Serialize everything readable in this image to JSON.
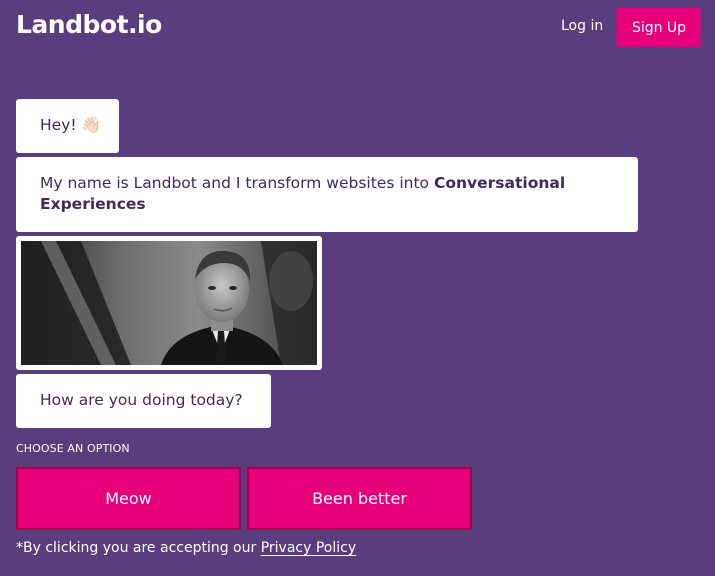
{
  "header": {
    "logo_text": "Landbot.io",
    "login_label": "Log in",
    "signup_label": "Sign Up"
  },
  "chat": {
    "greeting": "Hey! 👋🏻",
    "intro_text": "My name is Landbot and I transform websites into ",
    "intro_bold": "Conversational Experiences",
    "gif_alt": "animated gif of a man in a suit",
    "question": "How are you doing today?"
  },
  "options": {
    "label": "CHOOSE AN OPTION",
    "items": [
      {
        "label": "Meow"
      },
      {
        "label": "Been better"
      }
    ]
  },
  "footer": {
    "disclaimer_prefix": "*By clicking you are accepting our ",
    "privacy_label": "Privacy Policy"
  },
  "colors": {
    "background": "#5a3d7d",
    "accent": "#e8007a",
    "bubble": "#ffffff",
    "text": "#3f2a59"
  }
}
